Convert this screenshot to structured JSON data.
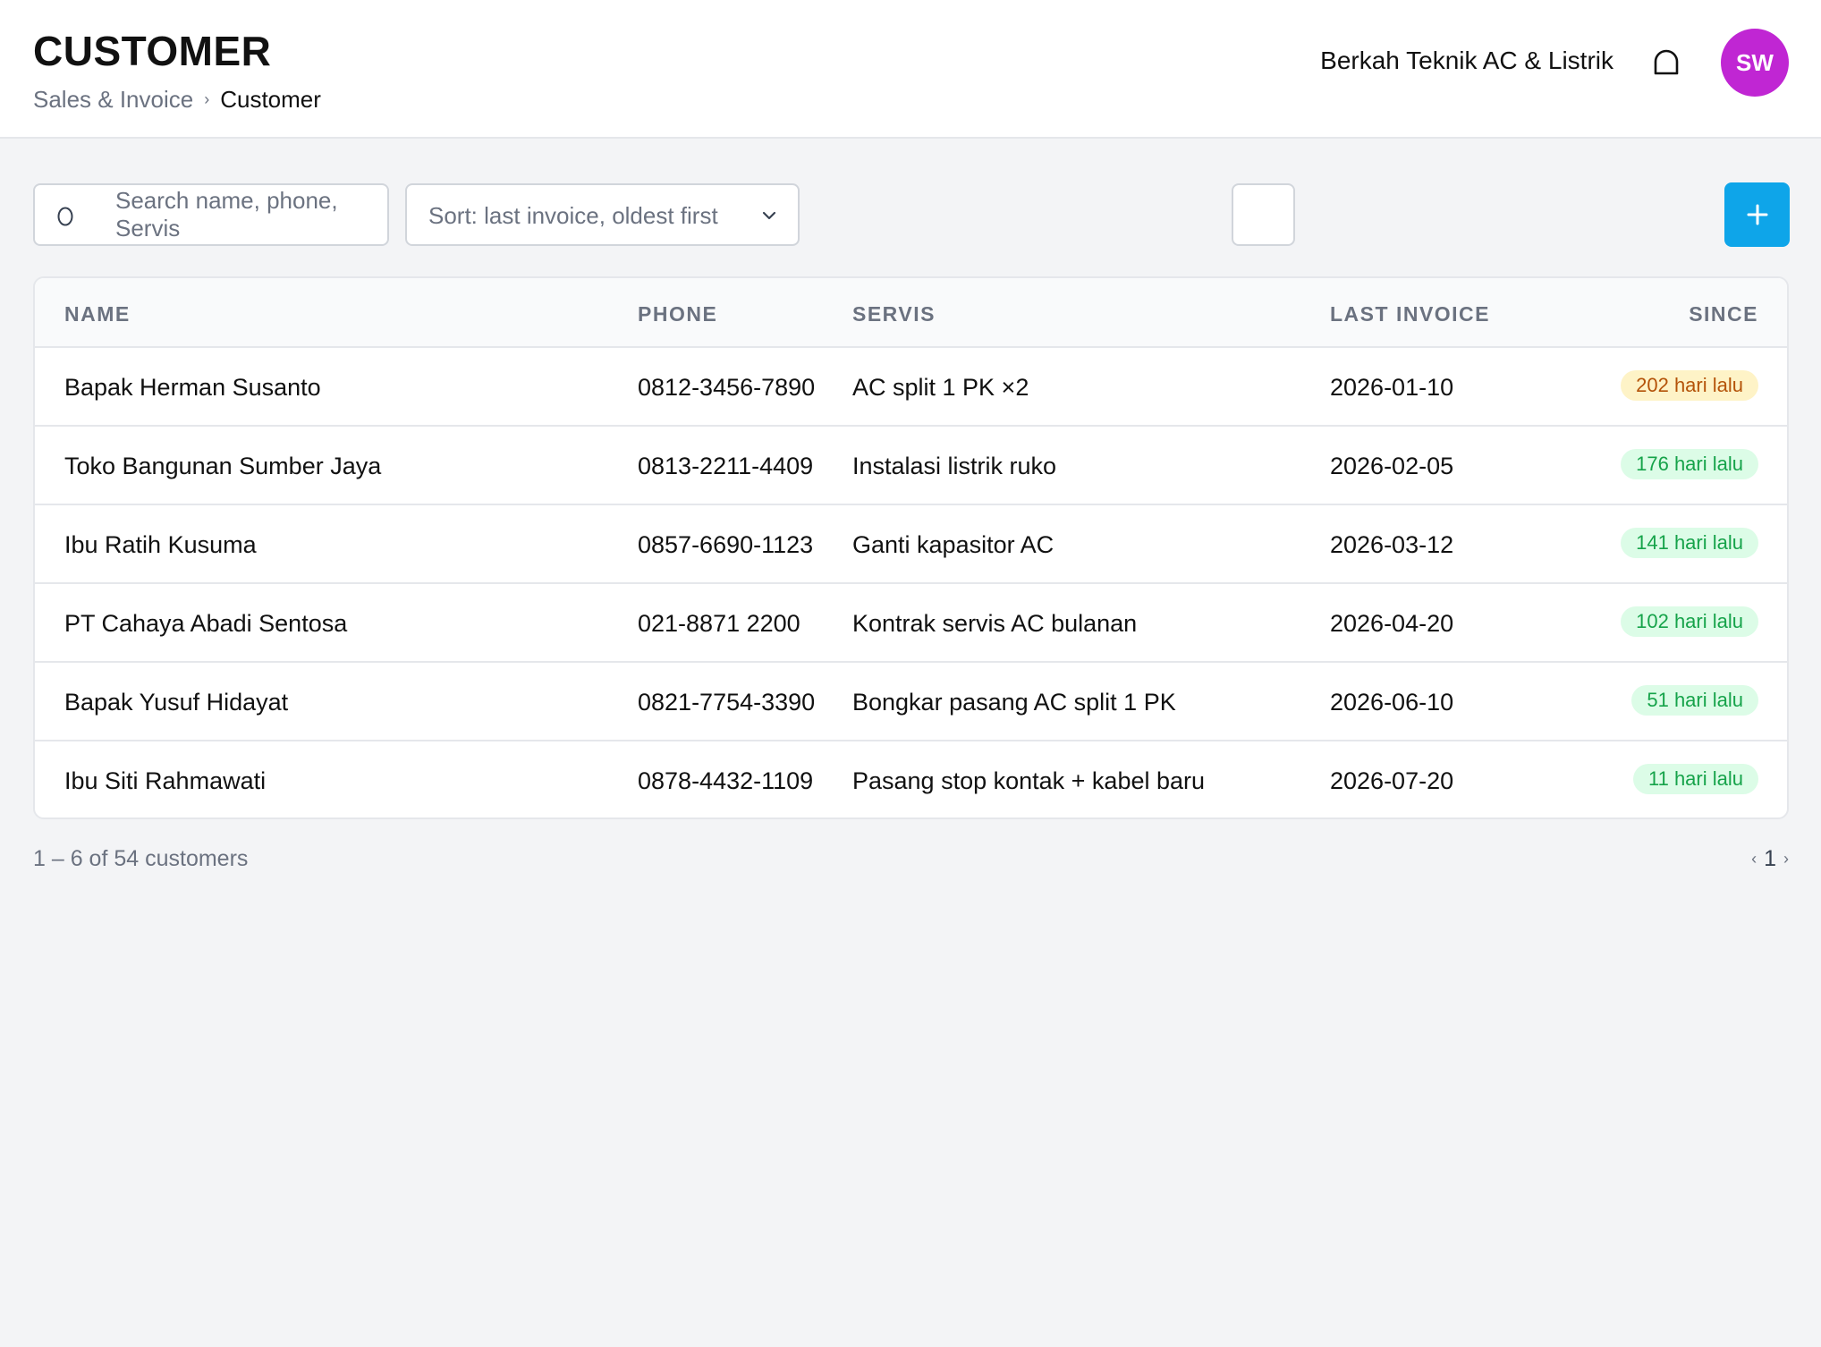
{
  "header": {
    "title": "CUSTOMER",
    "breadcrumb": {
      "parent": "Sales & Invoice",
      "separator": "›",
      "current": "Customer"
    },
    "company": "Berkah Teknik AC & Listrik",
    "avatar_initials": "SW",
    "avatar_color": "#c026d3"
  },
  "toolbar": {
    "search_placeholder": "Search name, phone, Servis",
    "sort_value": "Sort: last invoice, oldest first",
    "add_label": "+"
  },
  "table": {
    "columns": [
      "NAME",
      "PHONE",
      "SERVIS",
      "LAST INVOICE",
      "SINCE"
    ],
    "rows": [
      {
        "name": "Bapak Herman Susanto",
        "phone": "0812-3456-7890",
        "servis": "AC split 1 PK ×2",
        "last_invoice": "2026-01-10",
        "since": "202 hari lalu",
        "status": "warn"
      },
      {
        "name": "Toko Bangunan Sumber Jaya",
        "phone": "0813-2211-4409",
        "servis": "Instalasi listrik ruko",
        "last_invoice": "2026-02-05",
        "since": "176 hari lalu",
        "status": "ok"
      },
      {
        "name": "Ibu Ratih Kusuma",
        "phone": "0857-6690-1123",
        "servis": "Ganti kapasitor AC",
        "last_invoice": "2026-03-12",
        "since": "141 hari lalu",
        "status": "ok"
      },
      {
        "name": "PT Cahaya Abadi Sentosa",
        "phone": "021-8871 2200",
        "servis": "Kontrak servis AC bulanan",
        "last_invoice": "2026-04-20",
        "since": "102 hari lalu",
        "status": "ok"
      },
      {
        "name": "Bapak Yusuf Hidayat",
        "phone": "0821-7754-3390",
        "servis": "Bongkar pasang AC split 1 PK",
        "last_invoice": "2026-06-10",
        "since": "51 hari lalu",
        "status": "ok"
      },
      {
        "name": "Ibu Siti Rahmawati",
        "phone": "0878-4432-1109",
        "servis": "Pasang stop kontak + kabel baru",
        "last_invoice": "2026-07-20",
        "since": "11 hari lalu",
        "status": "ok"
      }
    ]
  },
  "footer": {
    "count_text": "1 – 6 of 54 customers",
    "prev": "‹",
    "page": "1",
    "next": "›"
  },
  "colors": {
    "accent": "#0ea5e9",
    "badge_warn_bg": "#fef3c7",
    "badge_warn_text": "#b45309",
    "badge_ok_bg": "#dcfce7",
    "badge_ok_text": "#16a34a"
  },
  "icons": {
    "search": "search-icon",
    "notification": "bell-icon",
    "sort": "chevron-down-icon",
    "add": "plus-icon"
  }
}
